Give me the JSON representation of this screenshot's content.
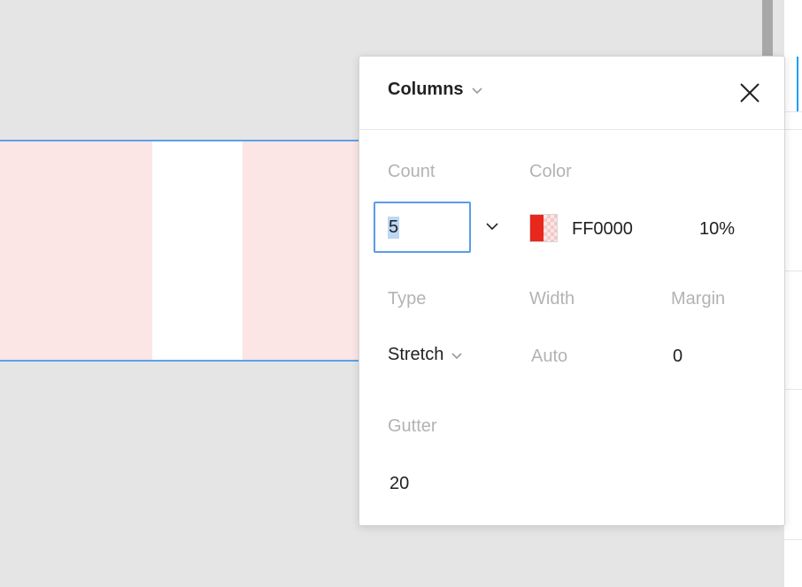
{
  "popover": {
    "title": "Columns",
    "close_icon": "close-icon",
    "title_chevron_icon": "chevron-down-icon"
  },
  "fields": {
    "count": {
      "label": "Count",
      "value": "5"
    },
    "color": {
      "label": "Color",
      "hex": "FF0000",
      "opacity": "10%",
      "swatch_color": "#e8281c"
    },
    "type": {
      "label": "Type",
      "value": "Stretch"
    },
    "width": {
      "label": "Width",
      "value": "Auto"
    },
    "margin": {
      "label": "Margin",
      "value": "0"
    },
    "gutter": {
      "label": "Gutter",
      "value": "20"
    }
  },
  "colors": {
    "column_fill": "#fbe5e5",
    "frame_border": "#5aa2ec",
    "focus_border": "#5b9be8",
    "canvas_bg": "#e5e5e5"
  }
}
